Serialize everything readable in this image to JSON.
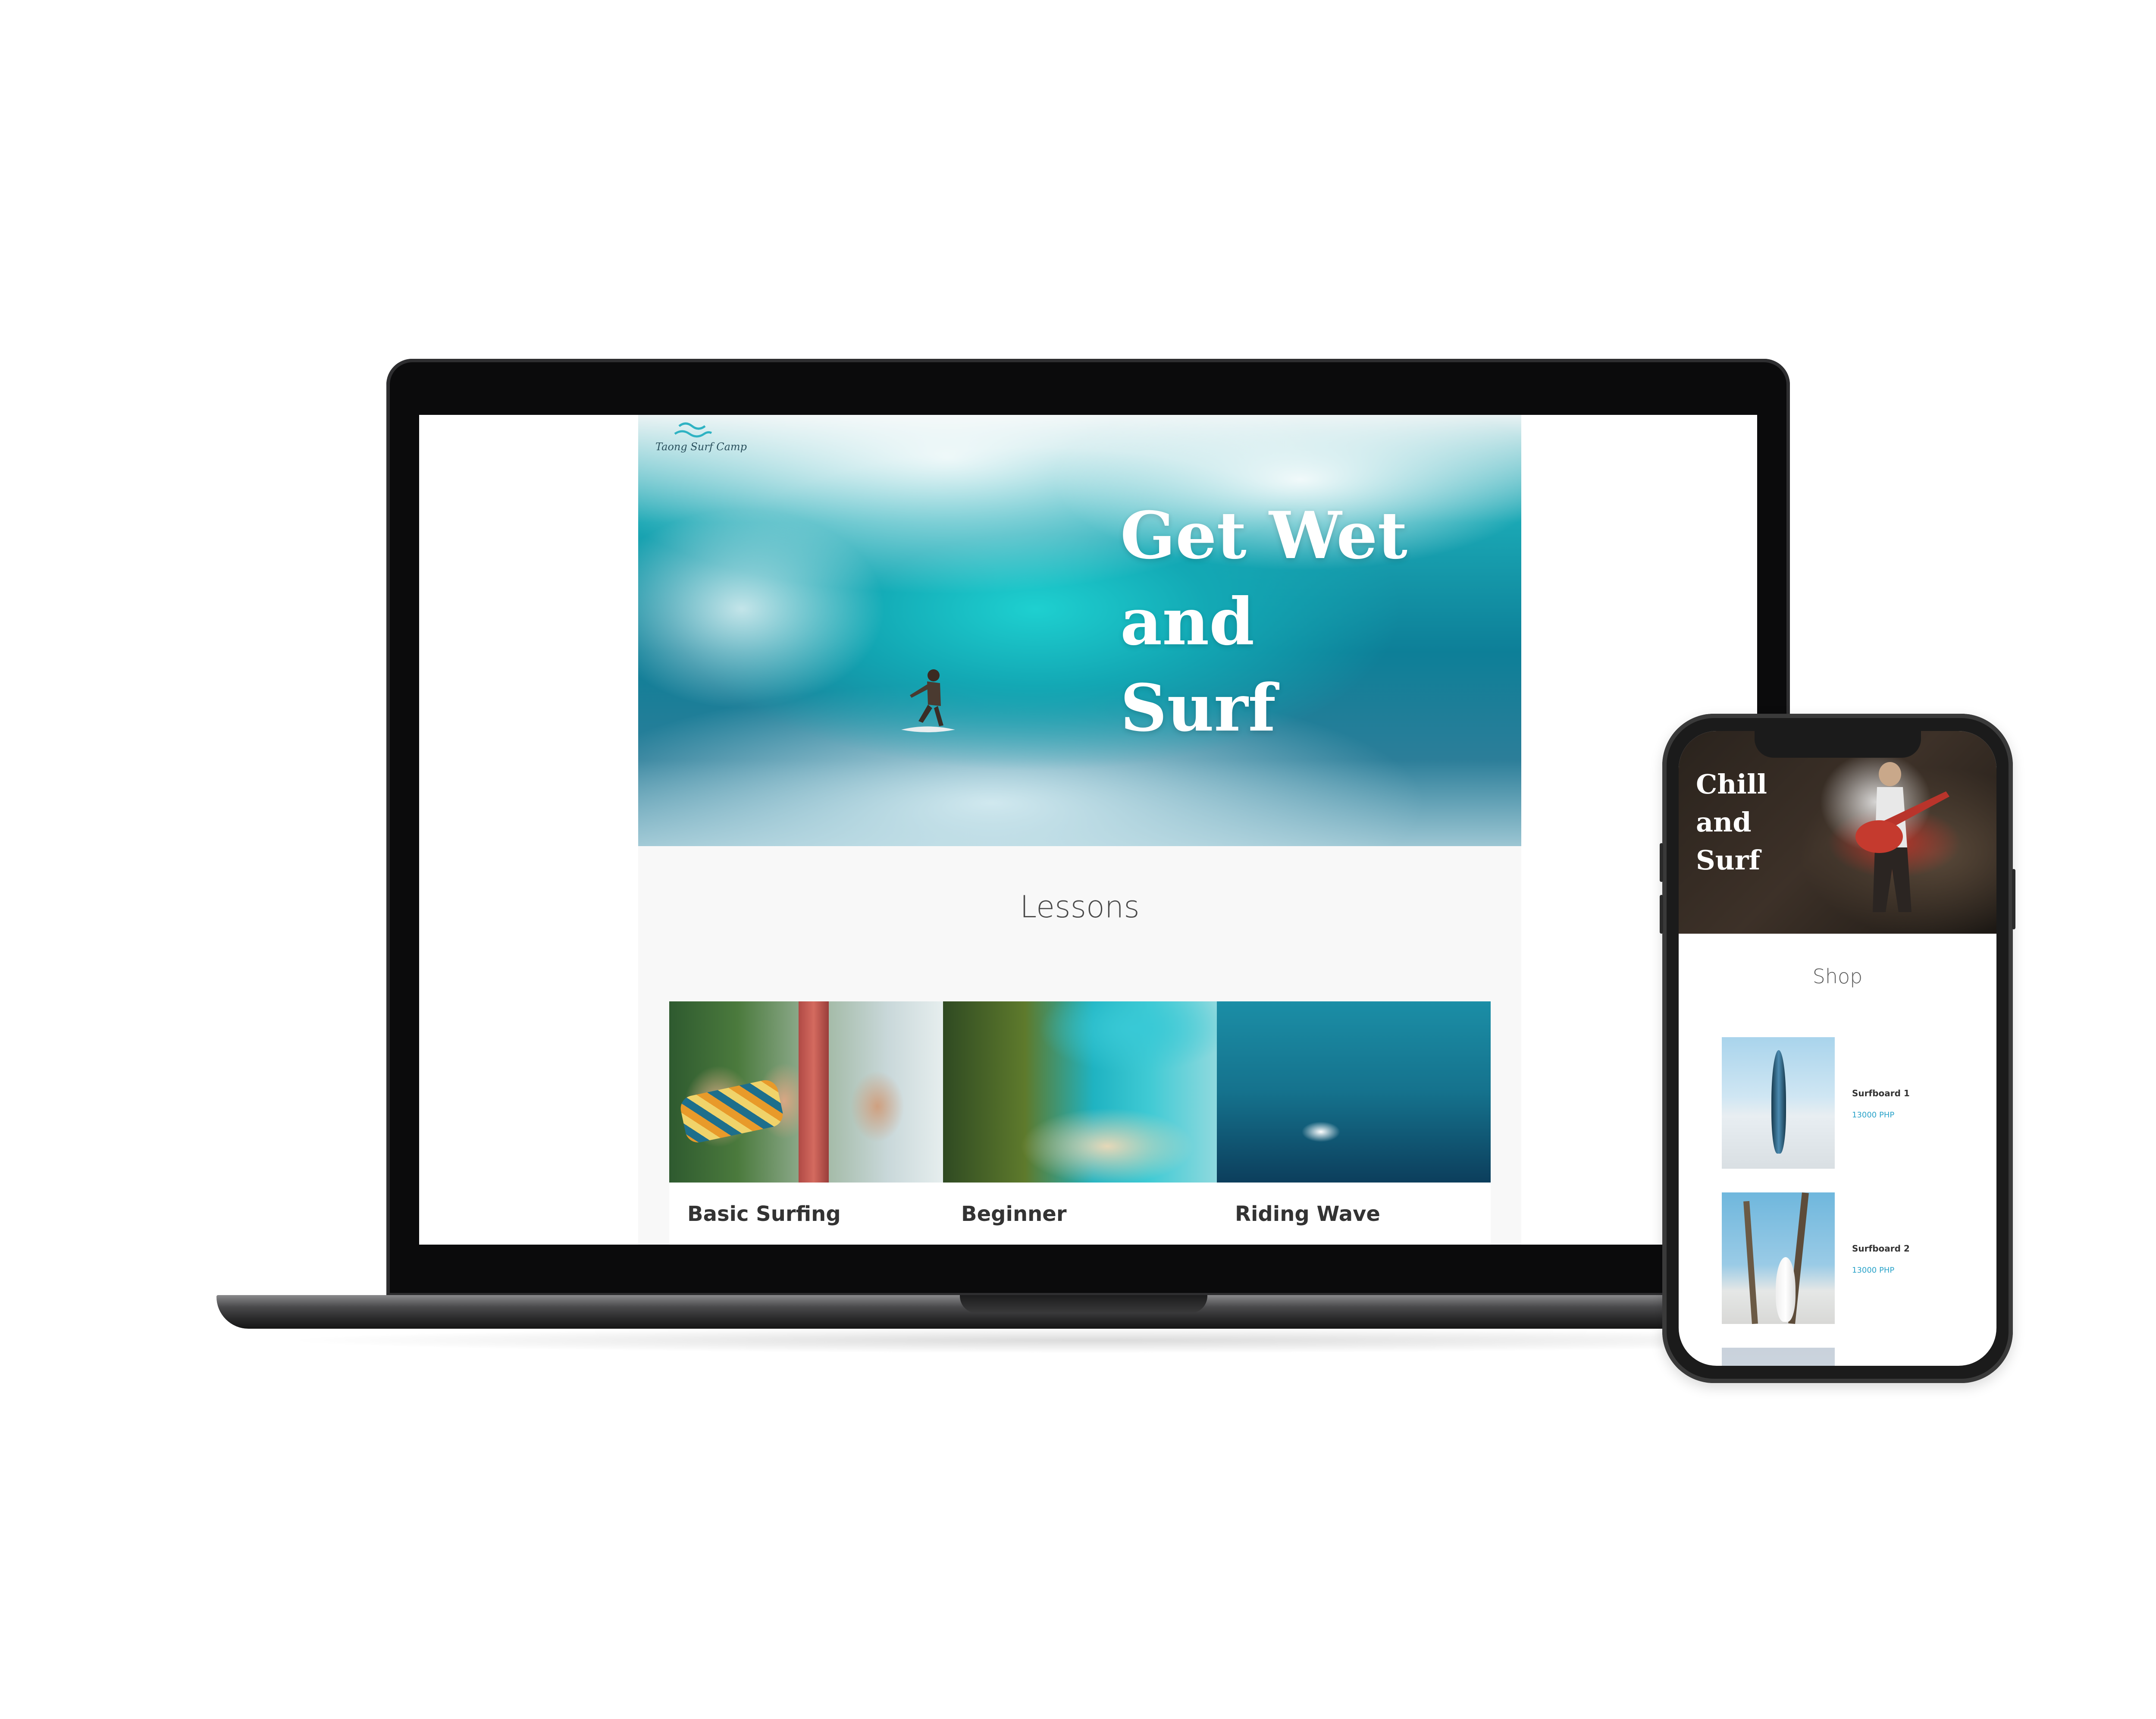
{
  "laptop_site": {
    "logo_text": "Taong Surf Camp",
    "hero_title_lines": [
      "Get Wet",
      "and",
      "Surf"
    ],
    "lessons_heading": "Lessons",
    "lessons": [
      {
        "label": "Basic Surfing"
      },
      {
        "label": "Beginner"
      },
      {
        "label": "Riding Wave"
      }
    ]
  },
  "phone_site": {
    "hero_title_lines": [
      "Chill",
      "and",
      "Surf"
    ],
    "shop_heading": "Shop",
    "products": [
      {
        "name": "Surfboard 1",
        "price": "13000 PHP"
      },
      {
        "name": "Surfboard 2",
        "price": "13000 PHP"
      }
    ]
  },
  "colors": {
    "accent_price": "#2aa3c9",
    "logo_wave": "#2fb3c3",
    "heading_text": "#4a4a4a"
  }
}
